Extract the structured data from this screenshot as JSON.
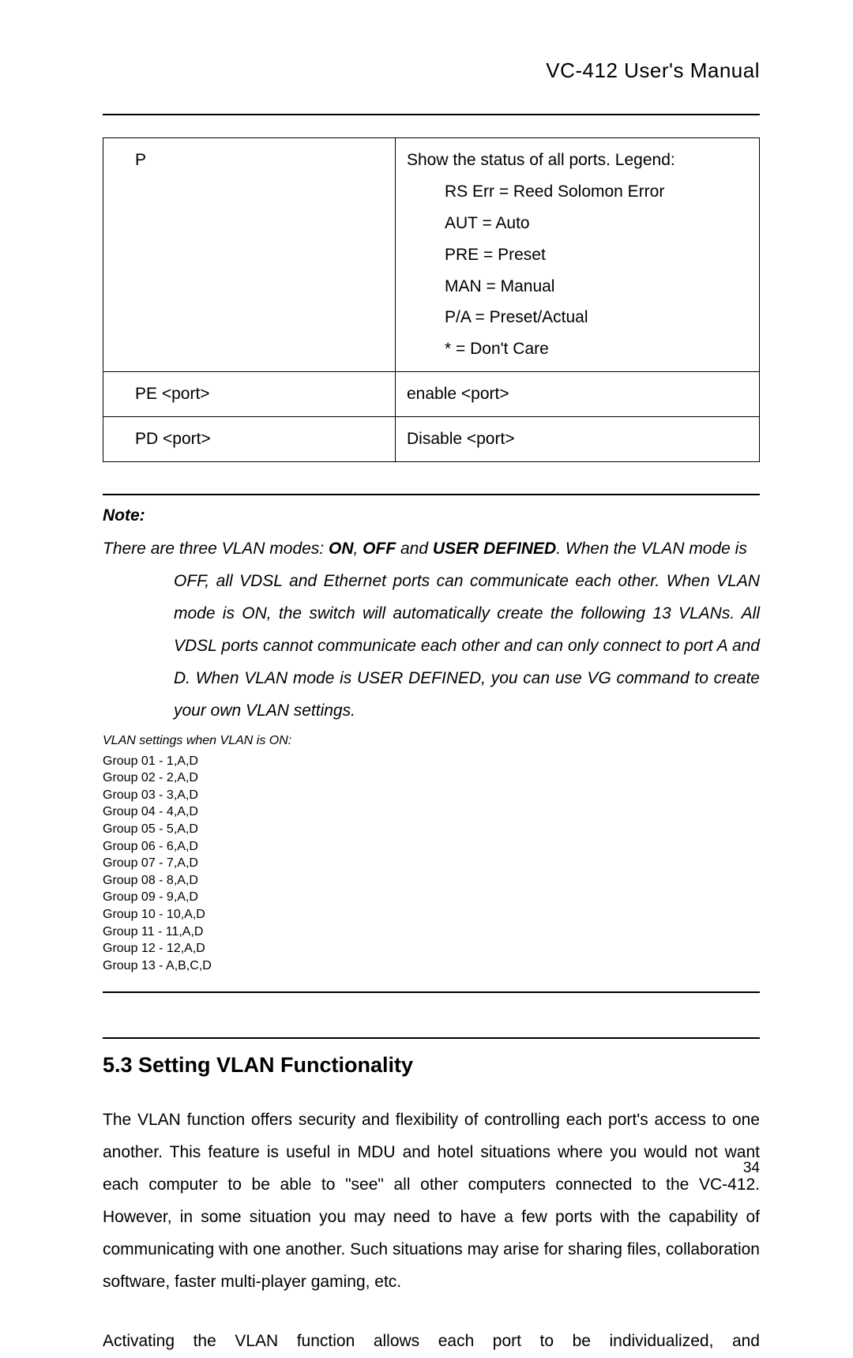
{
  "header": {
    "title": "VC-412  User's  Manual"
  },
  "table": {
    "rows": [
      {
        "c1": "P",
        "c2_lines": [
          "Show the status of all ports.    Legend:",
          "RS Err = Reed Solomon Error",
          "AUT = Auto",
          "PRE = Preset",
          "MAN = Manual",
          "P/A = Preset/Actual",
          "* = Don't Care"
        ]
      },
      {
        "c1": "PE <port>",
        "c2": "enable <port>"
      },
      {
        "c1": "PD <port>",
        "c2": "Disable <port>"
      }
    ]
  },
  "note": {
    "label": "Note:",
    "line1_pre": "There are three VLAN modes: ",
    "on": "ON",
    "sep1": ", ",
    "off": "OFF",
    "sep2": " and ",
    "ud": "USER DEFINED",
    "line1_post": ".    When the VLAN mode is",
    "rest": "OFF, all VDSL and Ethernet ports can communicate each other.   When VLAN mode is ON, the switch will automatically create the following 13 VLANs.   All VDSL ports cannot communicate each other and can only connect to port A and D.   When VLAN mode is USER DEFINED, you can use VG command to create your own VLAN settings.",
    "vlan_head": "VLAN settings when VLAN is ON:",
    "groups": "Group 01 - 1,A,D\nGroup 02 - 2,A,D\nGroup 03 - 3,A,D\nGroup 04 - 4,A,D\nGroup 05 - 5,A,D\nGroup 06 - 6,A,D\nGroup 07 - 7,A,D\nGroup 08 - 8,A,D\nGroup 09 - 9,A,D\nGroup 10 - 10,A,D\nGroup 11 - 11,A,D\nGroup 12 - 12,A,D\nGroup 13 - A,B,C,D"
  },
  "section": {
    "title": "5.3 Setting VLAN Functionality",
    "p1": "The VLAN function offers security and flexibility of controlling each port's access to one another. This feature is useful in MDU and hotel situations where you would not want each computer to be able to \"see\" all other computers connected to the VC-412. However, in some situation you may need to have a few ports with the capability of communicating with one another. Such situations may arise for sharing files, collaboration software, faster multi-player gaming, etc.",
    "p2": "Activating   the   VLAN   function   allows   each   port   to   be   individualized,   and"
  },
  "pagenum": "34"
}
